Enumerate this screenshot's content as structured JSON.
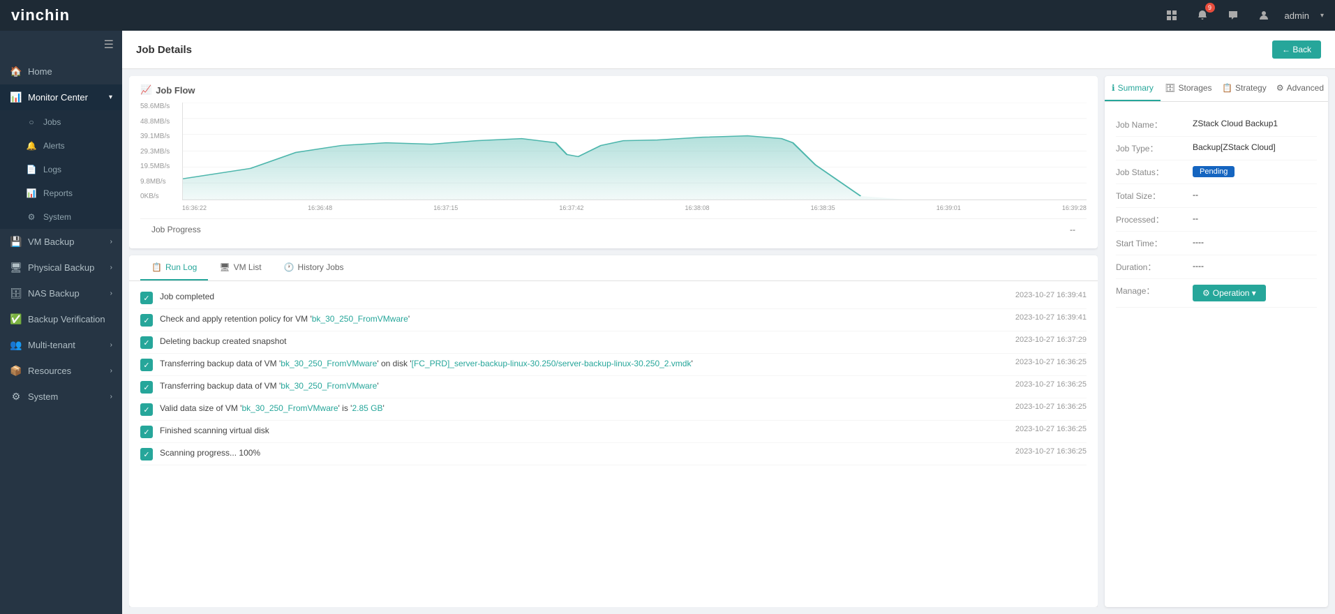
{
  "app": {
    "logo_v": "vin",
    "logo_chin": "chin",
    "notification_count": "9"
  },
  "top_nav": {
    "admin_label": "admin"
  },
  "sidebar": {
    "hamburger_label": "☰",
    "items": [
      {
        "id": "home",
        "icon": "🏠",
        "label": "Home",
        "active": false
      },
      {
        "id": "monitor-center",
        "icon": "📊",
        "label": "Monitor Center",
        "active": true,
        "expanded": true
      },
      {
        "id": "jobs",
        "icon": "",
        "label": "Jobs",
        "sub": true,
        "active": false
      },
      {
        "id": "alerts",
        "icon": "",
        "label": "Alerts",
        "sub": true,
        "active": false
      },
      {
        "id": "logs",
        "icon": "",
        "label": "Logs",
        "sub": true,
        "active": false
      },
      {
        "id": "reports",
        "icon": "",
        "label": "Reports",
        "sub": true,
        "active": false
      },
      {
        "id": "system-mon",
        "icon": "",
        "label": "System",
        "sub": true,
        "active": false
      },
      {
        "id": "vm-backup",
        "icon": "💾",
        "label": "VM Backup",
        "active": false
      },
      {
        "id": "physical-backup",
        "icon": "🖥",
        "label": "Physical Backup",
        "active": false
      },
      {
        "id": "nas-backup",
        "icon": "🗄",
        "label": "NAS Backup",
        "active": false
      },
      {
        "id": "backup-verification",
        "icon": "✅",
        "label": "Backup Verification",
        "active": false
      },
      {
        "id": "multi-tenant",
        "icon": "👥",
        "label": "Multi-tenant",
        "active": false
      },
      {
        "id": "resources",
        "icon": "📦",
        "label": "Resources",
        "active": false
      },
      {
        "id": "system",
        "icon": "⚙",
        "label": "System",
        "active": false
      }
    ]
  },
  "page": {
    "title": "Job Details",
    "back_btn": "← Back"
  },
  "chart": {
    "title": "Job Flow",
    "title_icon": "📈",
    "y_labels": [
      "58.6MB/s",
      "48.8MB/s",
      "39.1MB/s",
      "29.3MB/s",
      "19.5MB/s",
      "9.8MB/s",
      "0KB/s"
    ],
    "x_labels": [
      "16:36:22",
      "16:36:48",
      "16:37:15",
      "16:37:42",
      "16:38:08",
      "16:38:35",
      "16:39:01",
      "16:39:28"
    ]
  },
  "progress": {
    "label": "Job Progress",
    "dash": "--"
  },
  "tabs": [
    {
      "id": "run-log",
      "icon": "📋",
      "label": "Run Log",
      "active": true
    },
    {
      "id": "vm-list",
      "icon": "🖥",
      "label": "VM List",
      "active": false
    },
    {
      "id": "history-jobs",
      "icon": "🕐",
      "label": "History Jobs",
      "active": false
    }
  ],
  "log_entries": [
    {
      "id": 1,
      "text": "Job completed",
      "time": "2023-10-27 16:39:41",
      "plain": true
    },
    {
      "id": 2,
      "text_parts": [
        {
          "t": "Check and apply retention policy for VM '",
          "h": false
        },
        {
          "t": "bk_30_250_FromVMware",
          "h": true
        },
        {
          "t": "'",
          "h": false
        }
      ],
      "time": "2023-10-27 16:39:41"
    },
    {
      "id": 3,
      "text": "Deleting backup created snapshot",
      "time": "2023-10-27 16:37:29",
      "plain": true
    },
    {
      "id": 4,
      "text_parts": [
        {
          "t": "Transferring backup data of VM '",
          "h": false
        },
        {
          "t": "bk_30_250_FromVMware",
          "h": true
        },
        {
          "t": "' on disk '",
          "h": false
        },
        {
          "t": "[FC_PRD]_server-backup-linux-30.250/server-backup-linux-30.250_2.vmdk",
          "h": true
        },
        {
          "t": "'",
          "h": false
        }
      ],
      "time": "2023-10-27 16:36:25"
    },
    {
      "id": 5,
      "text_parts": [
        {
          "t": "Transferring backup data of VM '",
          "h": false
        },
        {
          "t": "bk_30_250_FromVMware",
          "h": true
        },
        {
          "t": "'",
          "h": false
        }
      ],
      "time": "2023-10-27 16:36:25"
    },
    {
      "id": 6,
      "text_parts": [
        {
          "t": "Valid data size of VM '",
          "h": false
        },
        {
          "t": "bk_30_250_FromVMware",
          "h": true
        },
        {
          "t": "' is '",
          "h": false
        },
        {
          "t": "2.85 GB",
          "h": true
        },
        {
          "t": "'",
          "h": false
        }
      ],
      "time": "2023-10-27 16:36:25"
    },
    {
      "id": 7,
      "text": "Finished scanning virtual disk",
      "time": "2023-10-27 16:36:25",
      "plain": true
    },
    {
      "id": 8,
      "text": "Scanning progress... 100%",
      "time": "2023-10-27 16:36:25",
      "plain": true
    }
  ],
  "right_panel": {
    "tabs": [
      {
        "id": "summary",
        "icon": "ℹ",
        "label": "Summary",
        "active": true
      },
      {
        "id": "storages",
        "icon": "🗄",
        "label": "Storages",
        "active": false
      },
      {
        "id": "strategy",
        "icon": "📋",
        "label": "Strategy",
        "active": false
      },
      {
        "id": "advanced",
        "icon": "⚙",
        "label": "Advanced",
        "active": false
      }
    ],
    "details": [
      {
        "label": "Job Name：",
        "value": "ZStack Cloud Backup1",
        "type": "text"
      },
      {
        "label": "Job Type：",
        "value": "Backup[ZStack Cloud]",
        "type": "text"
      },
      {
        "label": "Job Status：",
        "value": "Pending",
        "type": "badge"
      },
      {
        "label": "Total Size：",
        "value": "--",
        "type": "text"
      },
      {
        "label": "Processed：",
        "value": "--",
        "type": "text"
      },
      {
        "label": "Start Time：",
        "value": "----",
        "type": "text"
      },
      {
        "label": "Duration：",
        "value": "----",
        "type": "text"
      },
      {
        "label": "Manage：",
        "value": "Operation ▾",
        "type": "button"
      }
    ]
  }
}
